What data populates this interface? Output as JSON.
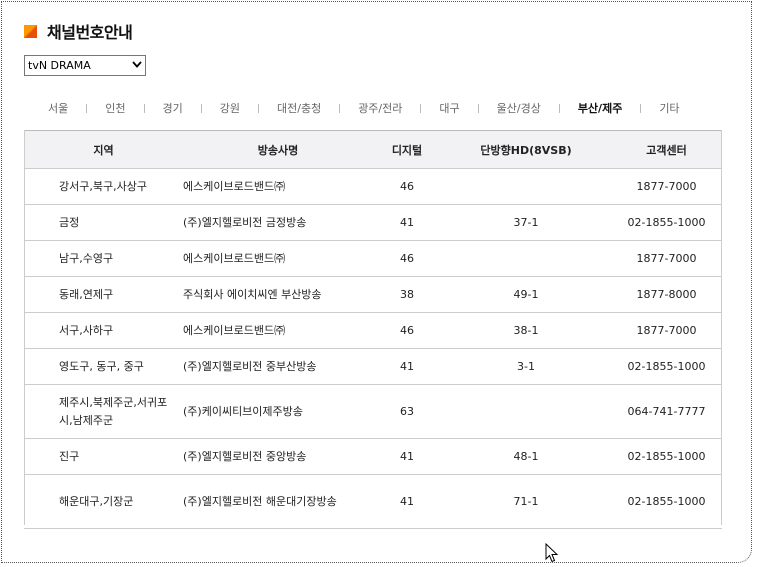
{
  "header": {
    "title": "채널번호안내"
  },
  "channel_select": {
    "value": "tvN DRAMA"
  },
  "regions": [
    {
      "label": "서울",
      "active": false
    },
    {
      "label": "인천",
      "active": false
    },
    {
      "label": "경기",
      "active": false
    },
    {
      "label": "강원",
      "active": false
    },
    {
      "label": "대전/충청",
      "active": false
    },
    {
      "label": "광주/전라",
      "active": false
    },
    {
      "label": "대구",
      "active": false
    },
    {
      "label": "울산/경상",
      "active": false
    },
    {
      "label": "부산/제주",
      "active": true
    },
    {
      "label": "기타",
      "active": false
    }
  ],
  "table": {
    "headers": {
      "region": "지역",
      "provider": "방송사명",
      "digital": "디지털",
      "hd": "단방향HD(8VSB)",
      "center": "고객센터"
    },
    "rows": [
      {
        "region": "강서구,북구,사상구",
        "provider": "에스케이브로드밴드㈜",
        "digital": "46",
        "hd": "",
        "center": "1877-7000"
      },
      {
        "region": "금정",
        "provider": "(주)엘지헬로비전 금정방송",
        "digital": "41",
        "hd": "37-1",
        "center": "02-1855-1000"
      },
      {
        "region": "남구,수영구",
        "provider": "에스케이브로드밴드㈜",
        "digital": "46",
        "hd": "",
        "center": "1877-7000"
      },
      {
        "region": "동래,연제구",
        "provider": "주식회사 에이치씨엔 부산방송",
        "digital": "38",
        "hd": "49-1",
        "center": "1877-8000"
      },
      {
        "region": "서구,사하구",
        "provider": "에스케이브로드밴드㈜",
        "digital": "46",
        "hd": "38-1",
        "center": "1877-7000"
      },
      {
        "region": "영도구, 동구, 중구",
        "provider": "(주)엘지헬로비전 중부산방송",
        "digital": "41",
        "hd": "3-1",
        "center": "02-1855-1000"
      },
      {
        "region": "제주시,북제주군,서귀포시,남제주군",
        "provider": "(주)케이씨티브이제주방송",
        "digital": "63",
        "hd": "",
        "center": "064-741-7777"
      },
      {
        "region": "진구",
        "provider": "(주)엘지헬로비전 중앙방송",
        "digital": "41",
        "hd": "48-1",
        "center": "02-1855-1000"
      },
      {
        "region": "해운대구,기장군",
        "provider": "(주)엘지헬로비전 해운대기장방송",
        "digital": "41",
        "hd": "71-1",
        "center": "02-1855-1000"
      }
    ]
  }
}
